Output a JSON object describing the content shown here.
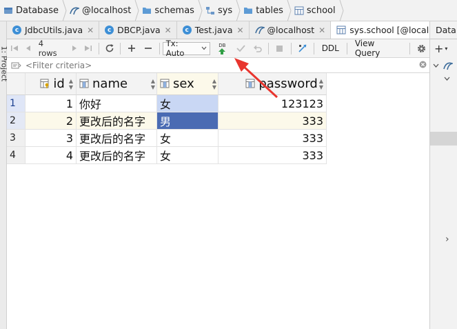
{
  "breadcrumb": [
    {
      "label": "Database",
      "icon": "database-icon"
    },
    {
      "label": "@localhost",
      "icon": "mysql-icon"
    },
    {
      "label": "schemas",
      "icon": "folder-icon"
    },
    {
      "label": "sys",
      "icon": "schema-icon"
    },
    {
      "label": "tables",
      "icon": "folder-icon"
    },
    {
      "label": "school",
      "icon": "table-icon"
    }
  ],
  "left_strip": {
    "label": "1: Project"
  },
  "tabs": [
    {
      "label": "JdbcUtils.java",
      "icon": "class-icon"
    },
    {
      "label": "DBCP.java",
      "icon": "class-icon"
    },
    {
      "label": "Test.java",
      "icon": "class-icon"
    },
    {
      "label": "@localhost",
      "icon": "mysql-icon"
    },
    {
      "label": "sys.school [@localh",
      "icon": "table-icon",
      "active": true
    }
  ],
  "toolbar": {
    "rows_label": "4 rows",
    "tx_label": "Tx: Auto",
    "submit_badge": "DB",
    "ddl_label": "DDL",
    "view_query_label": "View Query"
  },
  "filter": {
    "placeholder": "<Filter criteria>"
  },
  "grid": {
    "columns": [
      {
        "label": "id",
        "icon": "key-column-icon"
      },
      {
        "label": "name",
        "icon": "column-icon"
      },
      {
        "label": "sex",
        "icon": "column-icon"
      },
      {
        "label": "password",
        "icon": "column-icon"
      }
    ],
    "rows": [
      {
        "num": "1",
        "id": "1",
        "name": "你好",
        "sex": "女",
        "password": "123123"
      },
      {
        "num": "2",
        "id": "2",
        "name": "更改后的名字",
        "sex": "男",
        "password": "333"
      },
      {
        "num": "3",
        "id": "3",
        "name": "更改后的名字",
        "sex": "女",
        "password": "333"
      },
      {
        "num": "4",
        "id": "4",
        "name": "更改后的名字",
        "sex": "女",
        "password": "333"
      }
    ]
  },
  "right_panel": {
    "title": "Database"
  },
  "colors": {
    "accent": "#3d8fd6",
    "selection": "#4a6bb3",
    "arrow": "#e8352e",
    "submit_green": "#2f9e44"
  }
}
